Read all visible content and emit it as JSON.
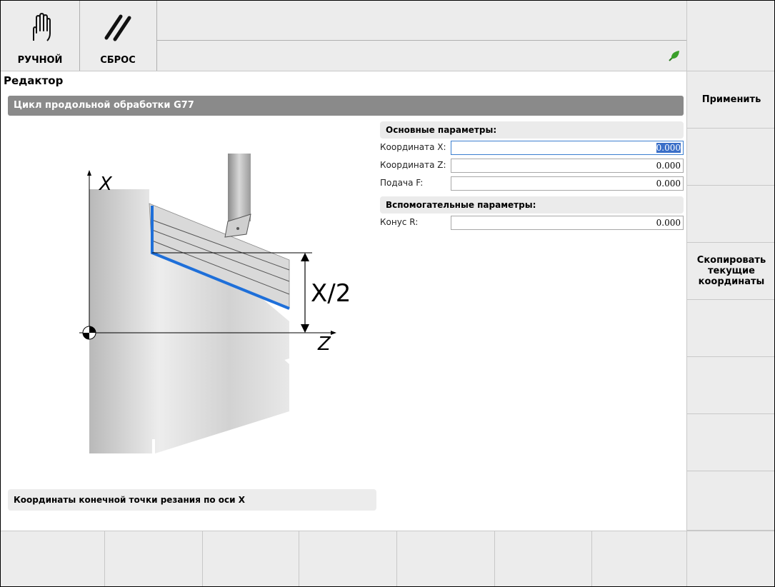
{
  "toolbar": {
    "mode_manual": {
      "label": "РУЧНОЙ",
      "icon": "hand-icon"
    },
    "reset": {
      "label": "СБРОС",
      "icon": "reset-slash-icon"
    },
    "status_icon": "leaf-icon",
    "status_icon_color": "#3aa02a"
  },
  "editor": {
    "title": "Редактор",
    "cycle_title": "Цикл продольной обработки G77",
    "diagram": {
      "axis_x": "X",
      "axis_z": "Z",
      "dimension": "X/2",
      "highlight_color": "#1e6fd9"
    },
    "groups": [
      {
        "title": "Основные параметры:",
        "params": [
          {
            "label": "Координата X:",
            "value": "0.000"
          },
          {
            "label": "Координата Z:",
            "value": "0.000"
          },
          {
            "label": "Подача F:",
            "value": "0.000"
          }
        ]
      },
      {
        "title": "Вспомогательные параметры:",
        "params": [
          {
            "label": "Конус R:",
            "value": "0.000"
          }
        ]
      }
    ],
    "hint": "Координаты конечной точки резания по оси X"
  },
  "softkeys": [
    "Применить",
    "",
    "",
    "Скопировать\nтекущие\nкоординаты",
    "",
    "",
    "",
    ""
  ],
  "bottom_keys": [
    "",
    "",
    "",
    "",
    "",
    "",
    "",
    ""
  ]
}
